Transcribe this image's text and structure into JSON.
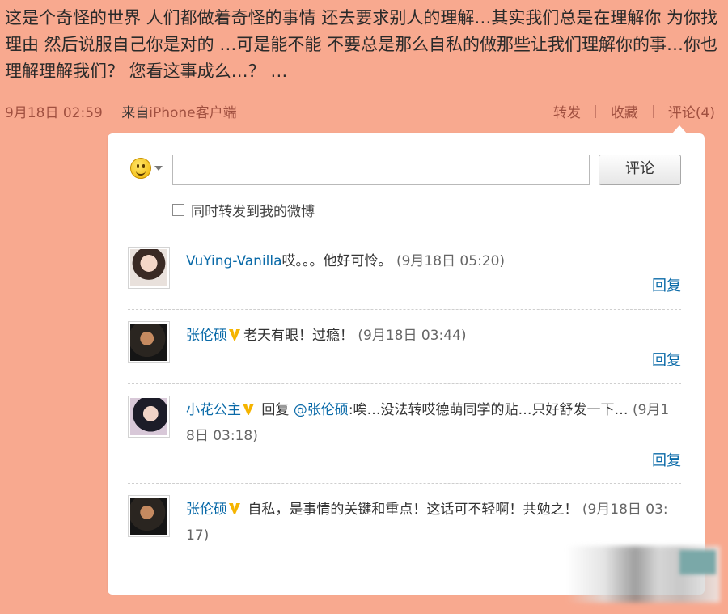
{
  "post": {
    "text": "这是个奇怪的世界 人们都做着奇怪的事情 还去要求别人的理解…其实我们总是在理解你 为你找理由 然后说服自己你是对的 …可是能不能 不要总是那么自私的做那些让我们理解你的事…你也理解理解我们？ 您看这事成么…？ …",
    "time": "9月18日 02:59",
    "source_label": "来自",
    "source_link": "iPhone客户端"
  },
  "actions": {
    "repost": "转发",
    "favorite": "收藏",
    "comment": "评论(4)"
  },
  "composer": {
    "emoji_icon": "smiley-face-icon",
    "input_value": "",
    "submit_label": "评论",
    "repost_checkbox_label": "同时转发到我的微博",
    "repost_checked": false
  },
  "comments": [
    {
      "user": "VuYing-Vanilla",
      "verified": false,
      "mention": "",
      "content": "哎。。。他好可怜。",
      "time": "(9月18日 05:20)",
      "reply_label": "回复"
    },
    {
      "user": "张伦硕",
      "verified": true,
      "mention": "",
      "content": "老天有眼！过瘾！",
      "time": "(9月18日 03:44)",
      "reply_label": "回复"
    },
    {
      "user": "小花公主",
      "verified": true,
      "reply_prefix": "回复",
      "mention": "@张伦硕",
      "content": ":唉…没法转哎德萌同学的贴…只好舒发一下… ",
      "time": "(9月18日 03:18)",
      "reply_label": "回复"
    },
    {
      "user": "张伦硕",
      "verified": true,
      "mention": "",
      "content": "自私，是事情的关键和重点！这话可不轻啊！共勉之！",
      "time": "(9月18日 03:17)",
      "reply_label": "回复"
    }
  ]
}
